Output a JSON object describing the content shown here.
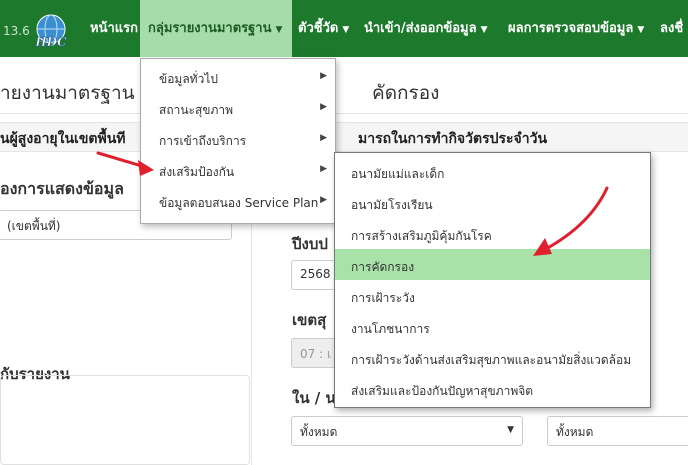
{
  "header": {
    "version": "13.6",
    "logo_text": "HDC",
    "nav": [
      {
        "label": "หน้าแรก"
      },
      {
        "label": "กลุ่มรายงานมาตรฐาน"
      },
      {
        "label": "ตัวชี้วัด"
      },
      {
        "label": "นำเข้า/ส่งออกข้อมูล"
      },
      {
        "label": "ผลการตรวจสอบข้อมูล"
      },
      {
        "label": "ลงชื่"
      }
    ]
  },
  "page": {
    "title_left": "ายงานมาตรฐาน",
    "title_right": "คัดกรอง",
    "subtitle_left": "นผู้สูงอายุในเขตพื้นที",
    "subtitle_right": "มารถในการทำกิจวัตรประจำวัน",
    "display_section": "องการแสดงข้อมูล",
    "display_select": "(เขตพื้นที่)",
    "report_section": "กับรายงาน",
    "year_label": "ปีงบป",
    "year_value": "2568",
    "region_label": "เขตสุ",
    "region_value": "07 : เ",
    "province_label": "ใน / น",
    "select_all_1": "ทั้งหมด",
    "select_all_2": "ทั้งหมด"
  },
  "menu1": {
    "items": [
      {
        "label": "ข้อมูลทั่วไป",
        "has_sub": true
      },
      {
        "label": "สถานะสุขภาพ",
        "has_sub": true
      },
      {
        "label": "การเข้าถึงบริการ",
        "has_sub": true
      },
      {
        "label": "ส่งเสริมป้องกัน",
        "has_sub": true
      },
      {
        "label": "ข้อมูลตอบสนอง Service Plan",
        "has_sub": true
      }
    ]
  },
  "menu2": {
    "items": [
      {
        "label": "อนามัยแม่และเด็ก"
      },
      {
        "label": "อนามัยโรงเรียน"
      },
      {
        "label": "การสร้างเสริมภูมิคุ้มกันโรค"
      },
      {
        "label": "การคัดกรอง"
      },
      {
        "label": "การเฝ้าระวัง"
      },
      {
        "label": "งานโภชนาการ"
      },
      {
        "label": "การเฝ้าระวังด้านส่งเสริมสุขภาพและอนามัยสิ่งแวดล้อม"
      },
      {
        "label": "ส่งเสริมและป้องกันปัญหาสุขภาพจิต"
      }
    ],
    "highlighted": "การคัดกรอง"
  },
  "colors": {
    "nav_bg": "#1d7a2c",
    "nav_active": "#a6dca9",
    "highlight": "#a8e2a8",
    "annotation_arrow": "#e0202e"
  }
}
